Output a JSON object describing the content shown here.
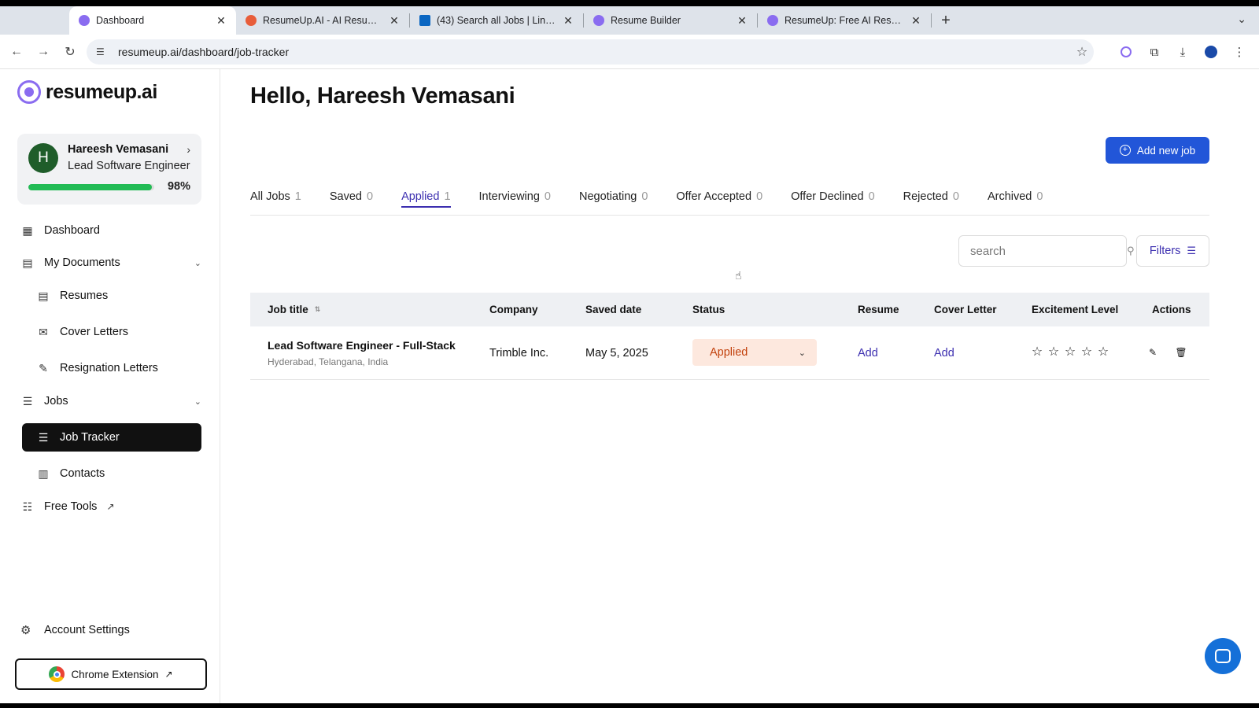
{
  "browser": {
    "tabs": [
      {
        "title": "Dashboard",
        "active": true,
        "favicon_color": "#8a6cf0"
      },
      {
        "title": "ResumeUp.AI - AI Resume Builder",
        "active": false,
        "favicon_color": "#e85d3a"
      },
      {
        "title": "(43) Search all Jobs | LinkedIn",
        "active": false,
        "favicon_color": "#0a66c2"
      },
      {
        "title": "Resume Builder",
        "active": false,
        "favicon_color": "#8a6cf0"
      },
      {
        "title": "ResumeUp: Free AI Resume Builder",
        "active": false,
        "favicon_color": "#8a6cf0"
      }
    ],
    "url": "resumeup.ai/dashboard/job-tracker"
  },
  "brand": {
    "name": "resumeup.ai",
    "color": "#8a6cf0"
  },
  "profile": {
    "initial": "H",
    "name": "Hareesh Vemasani",
    "role": "Lead Software Engineer",
    "completion": 0.98,
    "completion_label": "98%"
  },
  "sidebar": {
    "dashboard": "Dashboard",
    "my_documents": "My Documents",
    "resumes": "Resumes",
    "cover_letters": "Cover Letters",
    "resignation_letters": "Resignation Letters",
    "jobs": "Jobs",
    "job_tracker": "Job Tracker",
    "contacts": "Contacts",
    "free_tools": "Free Tools",
    "account_settings": "Account Settings",
    "chrome_extension": "Chrome Extension"
  },
  "main": {
    "greeting": "Hello, Hareesh Vemasani",
    "add_job_label": "Add new job",
    "accent_color": "#2256d8",
    "tabs": [
      {
        "label": "All Jobs",
        "count": "1",
        "active": false
      },
      {
        "label": "Saved",
        "count": "0",
        "active": false
      },
      {
        "label": "Applied",
        "count": "1",
        "active": true
      },
      {
        "label": "Interviewing",
        "count": "0",
        "active": false
      },
      {
        "label": "Negotiating",
        "count": "0",
        "active": false
      },
      {
        "label": "Offer Accepted",
        "count": "0",
        "active": false
      },
      {
        "label": "Offer Declined",
        "count": "0",
        "active": false
      },
      {
        "label": "Rejected",
        "count": "0",
        "active": false
      },
      {
        "label": "Archived",
        "count": "0",
        "active": false
      }
    ],
    "search": {
      "placeholder": "search",
      "value": ""
    },
    "filters_label": "Filters"
  },
  "table": {
    "headers": {
      "job_title": "Job title",
      "company": "Company",
      "saved_date": "Saved date",
      "status": "Status",
      "resume": "Resume",
      "cover_letter": "Cover Letter",
      "excitement": "Excitement Level",
      "actions": "Actions"
    },
    "rows": [
      {
        "job_title": "Lead Software Engineer - Full-Stack",
        "location": "Hyderabad, Telangana, India",
        "company": "Trimble Inc.",
        "saved_date": "May 5, 2025",
        "status": "Applied",
        "resume": "Add",
        "cover_letter": "Add",
        "excitement_level": 0,
        "excitement_max": 5
      }
    ]
  }
}
